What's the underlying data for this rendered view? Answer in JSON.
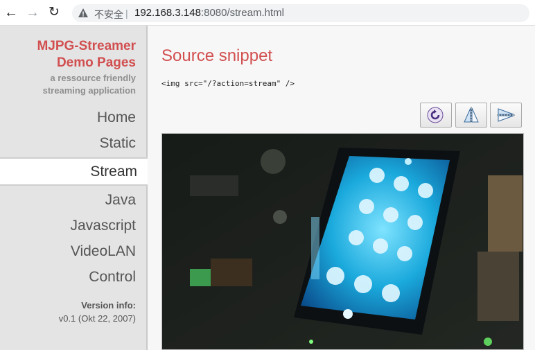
{
  "browser": {
    "security_label": "不安全",
    "separator": "|",
    "url_host": "192.168.3.148",
    "url_rest": ":8080/stream.html",
    "icons": [
      "back-arrow-icon",
      "forward-arrow-icon",
      "reload-icon",
      "warning-icon"
    ]
  },
  "sidebar": {
    "brand_line1": "MJPG-Streamer",
    "brand_line2": "Demo Pages",
    "tagline_line1": "a ressource friendly",
    "tagline_line2": "streaming application",
    "items": [
      {
        "label": "Home"
      },
      {
        "label": "Static"
      },
      {
        "label": "Stream"
      },
      {
        "label": "Java"
      },
      {
        "label": "Javascript"
      },
      {
        "label": "VideoLAN"
      },
      {
        "label": "Control"
      }
    ],
    "active_item": "Stream",
    "version_label": "Version info:",
    "version_value": "v0.1 (Okt 22, 2007)"
  },
  "main": {
    "heading": "Source snippet",
    "snippet": "<img src=\"/?action=stream\" />",
    "toolbar": {
      "icons": [
        "rotate-icon",
        "flip-vertical-icon",
        "flip-horizontal-icon"
      ]
    }
  },
  "colors": {
    "accent": "#d24f50",
    "sidebar_bg": "#e4e4e4",
    "screen_glow": "#2ab8e8"
  }
}
